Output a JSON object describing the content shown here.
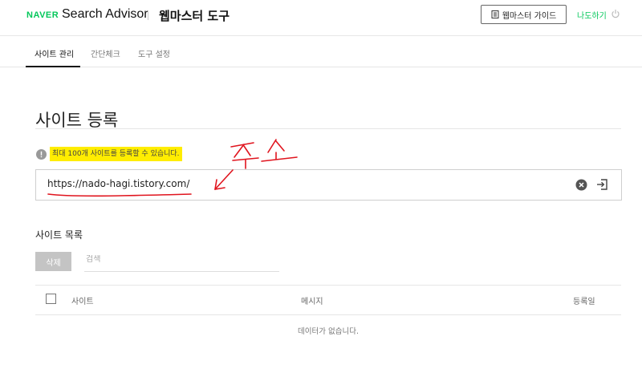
{
  "header": {
    "brand_logo_text": "NAVER",
    "product_name": "Search Advisor",
    "tool_name": "웹마스터 도구",
    "guide_button_label": "웹마스터 가이드",
    "user_name": "나도하기",
    "guide_icon": "document-icon",
    "logout_icon": "power-icon"
  },
  "tabs": [
    {
      "label": "사이트 관리",
      "active": true
    },
    {
      "label": "간단체크",
      "active": false
    },
    {
      "label": "도구 설정",
      "active": false
    }
  ],
  "page": {
    "title": "사이트 등록",
    "notice": "최대 100개 사이트를 등록할 수 있습니다.",
    "url_input_value": "https://nado-hagi.tistory.com/"
  },
  "annotation": {
    "handwritten_text": "주소"
  },
  "site_list": {
    "section_title": "사이트 목록",
    "delete_button_label": "삭제",
    "search_placeholder": "검색",
    "columns": [
      "사이트",
      "메시지",
      "등록일"
    ],
    "empty_message": "데이터가 없습니다."
  },
  "colors": {
    "brand_green": "#03c75a",
    "notice_highlight": "#ffed00",
    "annotation_red": "#e0141e",
    "disabled_button": "#c4c4c4"
  }
}
